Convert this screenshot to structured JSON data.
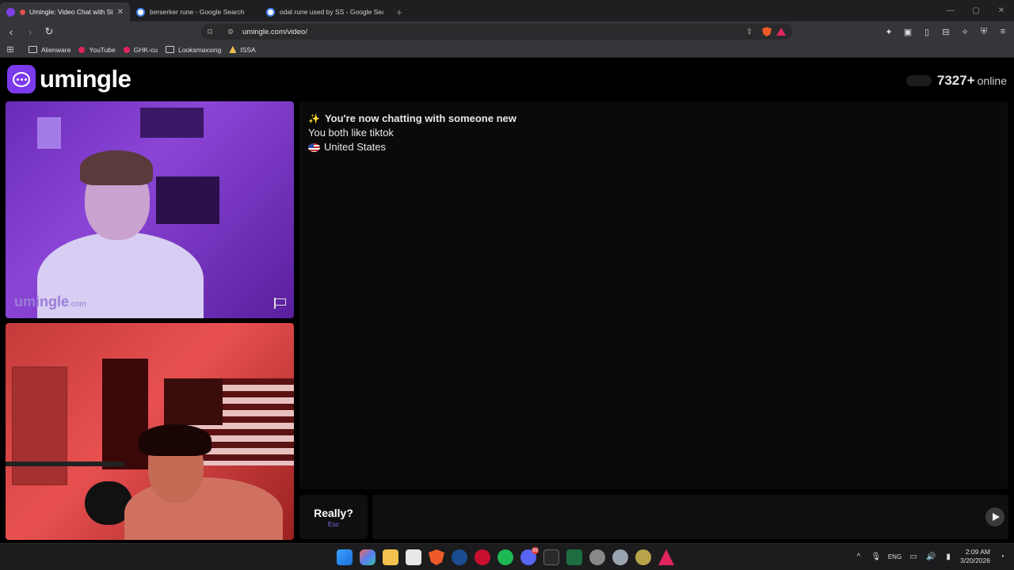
{
  "browser": {
    "tabs": [
      {
        "title": "Umingle: Video Chat with Str",
        "active": true,
        "icon": "umingle-icon"
      },
      {
        "title": "berserker rune - Google Search",
        "active": false,
        "icon": "google-icon"
      },
      {
        "title": "odal rune used by SS - Google Search",
        "active": false,
        "icon": "google-icon"
      }
    ],
    "url": "umingle.com/video/",
    "bookmarks": [
      {
        "label": "Alienware",
        "icon": "folder-icon"
      },
      {
        "label": "YouTube",
        "icon": "youtube-icon"
      },
      {
        "label": "GHK-cu",
        "icon": "youtube-icon"
      },
      {
        "label": "Looksmaxxing",
        "icon": "folder-icon"
      },
      {
        "label": "ISSA",
        "icon": "issa-icon"
      }
    ]
  },
  "site": {
    "logo_text": "umingle",
    "online_count": "7327+",
    "online_label": "online",
    "accent": "#7c3aed"
  },
  "video": {
    "watermark_main": "umingle",
    "watermark_sub": ".com"
  },
  "chat": {
    "messages": [
      {
        "icon": "sparkle-icon",
        "text": "You're now chatting with someone new"
      },
      {
        "text": "You both like tiktok"
      },
      {
        "icon": "us-flag-icon",
        "text": "United States"
      }
    ]
  },
  "controls": {
    "skip_label": "Really?",
    "skip_key": "Esc",
    "message_placeholder": ""
  },
  "taskbar": {
    "discord_badge": "99",
    "language": "ENG",
    "time": "2:09 AM",
    "date": "3/20/2026"
  }
}
